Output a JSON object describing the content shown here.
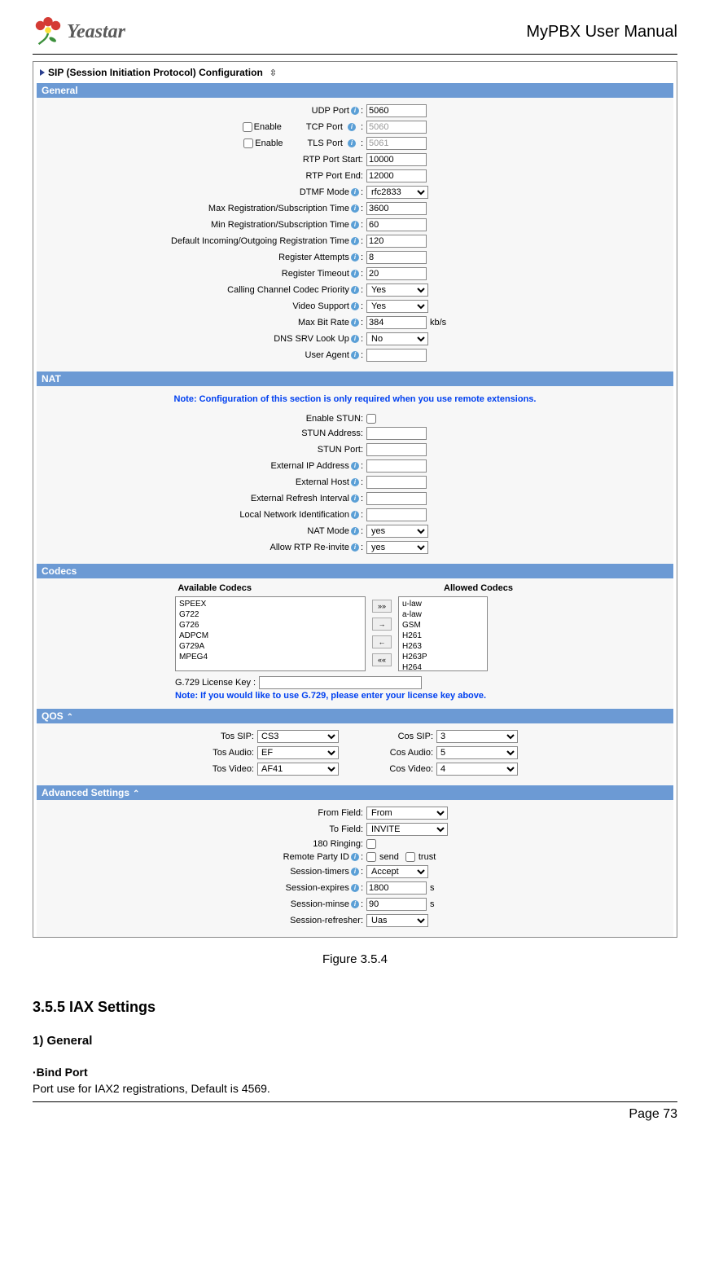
{
  "header": {
    "brand": "Yeastar",
    "title": "MyPBX User Manual"
  },
  "shot": {
    "title": "SIP (Session Initiation Protocol) Configuration"
  },
  "general": {
    "bar": "General",
    "enable_label": "Enable",
    "rows": {
      "udp_port": {
        "label": "UDP Port",
        "value": "5060"
      },
      "tcp_port": {
        "label": "TCP Port",
        "value": "5060"
      },
      "tls_port": {
        "label": "TLS Port",
        "value": "5061"
      },
      "rtp_start": {
        "label": "RTP Port Start:",
        "value": "10000"
      },
      "rtp_end": {
        "label": "RTP Port End:",
        "value": "12000"
      },
      "dtmf": {
        "label": "DTMF Mode",
        "value": "rfc2833"
      },
      "max_reg": {
        "label": "Max Registration/Subscription Time",
        "value": "3600"
      },
      "min_reg": {
        "label": "Min Registration/Subscription Time",
        "value": "60"
      },
      "def_reg": {
        "label": "Default Incoming/Outgoing Registration Time",
        "value": "120"
      },
      "reg_att": {
        "label": "Register Attempts",
        "value": "8"
      },
      "reg_to": {
        "label": "Register Timeout",
        "value": "20"
      },
      "codec_pri": {
        "label": "Calling Channel Codec Priority",
        "value": "Yes"
      },
      "video": {
        "label": "Video Support",
        "value": "Yes"
      },
      "max_bit": {
        "label": "Max Bit Rate",
        "value": "384",
        "suffix": "kb/s"
      },
      "dns_srv": {
        "label": "DNS SRV Look Up",
        "value": "No"
      },
      "user_agent": {
        "label": "User Agent",
        "value": ""
      }
    }
  },
  "nat": {
    "bar": "NAT",
    "note": "Note: Configuration of this section is only required when you use remote extensions.",
    "rows": {
      "enable_stun": {
        "label": "Enable STUN:"
      },
      "stun_addr": {
        "label": "STUN Address:",
        "value": ""
      },
      "stun_port": {
        "label": "STUN Port:",
        "value": ""
      },
      "ext_ip": {
        "label": "External IP Address",
        "value": ""
      },
      "ext_host": {
        "label": "External Host",
        "value": ""
      },
      "ext_refresh": {
        "label": "External Refresh Interval",
        "value": ""
      },
      "local_net": {
        "label": "Local Network Identification",
        "value": ""
      },
      "nat_mode": {
        "label": "NAT Mode",
        "value": "yes"
      },
      "rtp_reinvite": {
        "label": "Allow RTP Re-invite",
        "value": "yes"
      }
    }
  },
  "codecs": {
    "bar": "Codecs",
    "avail_h": "Available Codecs",
    "allow_h": "Allowed Codecs",
    "available": [
      "SPEEX",
      "G722",
      "G726",
      "ADPCM",
      "G729A",
      "MPEG4"
    ],
    "allowed": [
      "u-law",
      "a-law",
      "GSM",
      "H261",
      "H263",
      "H263P",
      "H264"
    ],
    "g729_label": "G.729 License Key :",
    "note": "Note: If you would like to use G.729, please enter your license key above."
  },
  "qos": {
    "bar": "QOS",
    "tos_sip": {
      "label": "Tos SIP:",
      "value": "CS3"
    },
    "cos_sip": {
      "label": "Cos SIP:",
      "value": "3"
    },
    "tos_audio": {
      "label": "Tos Audio:",
      "value": "EF"
    },
    "cos_audio": {
      "label": "Cos Audio:",
      "value": "5"
    },
    "tos_video": {
      "label": "Tos Video:",
      "value": "AF41"
    },
    "cos_video": {
      "label": "Cos Video:",
      "value": "4"
    }
  },
  "adv": {
    "bar": "Advanced Settings",
    "rows": {
      "from_field": {
        "label": "From Field:",
        "value": "From"
      },
      "to_field": {
        "label": "To Field:",
        "value": "INVITE"
      },
      "ringing": {
        "label": "180 Ringing:"
      },
      "rpid": {
        "label": "Remote Party ID",
        "cb1": "send",
        "cb2": "trust"
      },
      "sess_timers": {
        "label": "Session-timers",
        "value": "Accept"
      },
      "sess_exp": {
        "label": "Session-expires",
        "value": "1800",
        "suffix": "s"
      },
      "sess_minse": {
        "label": "Session-minse",
        "value": "90",
        "suffix": "s"
      },
      "sess_refresh": {
        "label": "Session-refresher:",
        "value": "Uas"
      }
    }
  },
  "caption": "Figure 3.5.4",
  "doc": {
    "h3": "3.5.5 IAX Settings",
    "h4": "1) General",
    "h5": "·Bind Port",
    "p": "Port use for IAX2 registrations, Default is 4569."
  },
  "footer": "Page 73"
}
